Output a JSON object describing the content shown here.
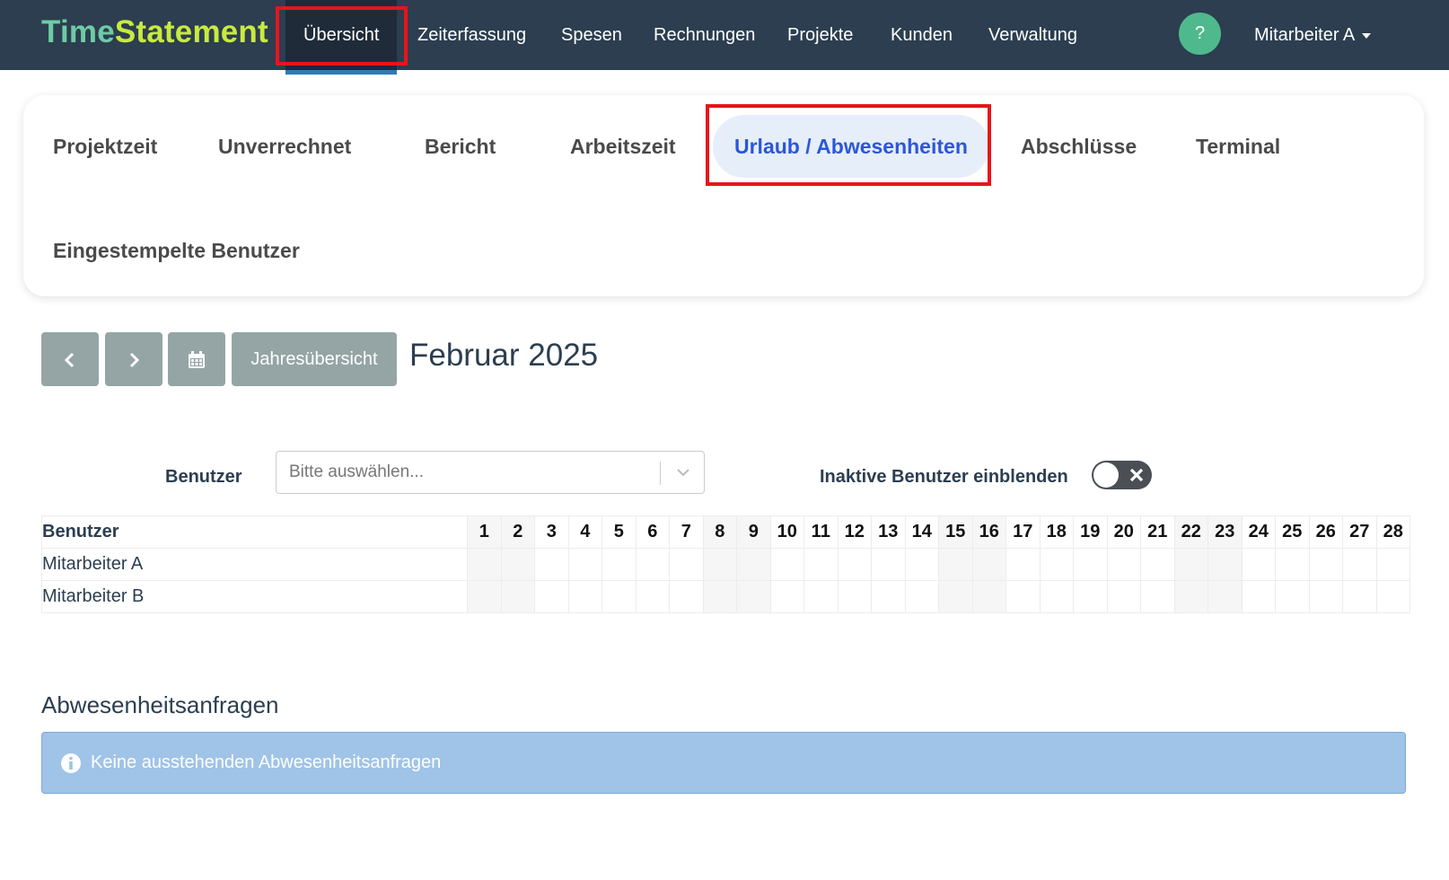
{
  "navbar": {
    "brand_part1": "Time",
    "brand_part2": "Statement",
    "items": [
      "Übersicht",
      "Zeiterfassung",
      "Spesen",
      "Rechnungen",
      "Projekte",
      "Kunden",
      "Verwaltung"
    ],
    "active_item": "Übersicht",
    "help_label": "?",
    "user_label": "Mitarbeiter A"
  },
  "tabs": {
    "items": [
      "Projektzeit",
      "Unverrechnet",
      "Bericht",
      "Arbeitszeit",
      "Urlaub / Abwesenheiten",
      "Abschlüsse",
      "Terminal",
      "Eingestempelte Benutzer"
    ],
    "active": "Urlaub / Abwesenheiten"
  },
  "toolbar": {
    "prev_icon": "chevron-left-icon",
    "next_icon": "chevron-right-icon",
    "calendar_icon": "calendar-icon",
    "year_overview_label": "Jahresübersicht",
    "month_title": "Februar 2025"
  },
  "filter": {
    "user_label": "Benutzer",
    "user_placeholder": "Bitte auswählen...",
    "toggle_label": "Inaktive Benutzer einblenden",
    "toggle_on": false
  },
  "calendar": {
    "name_header": "Benutzer",
    "days": [
      "1",
      "2",
      "3",
      "4",
      "5",
      "6",
      "7",
      "8",
      "9",
      "10",
      "11",
      "12",
      "13",
      "14",
      "15",
      "16",
      "17",
      "18",
      "19",
      "20",
      "21",
      "22",
      "23",
      "24",
      "25",
      "26",
      "27",
      "28"
    ],
    "weekend_days": [
      1,
      2,
      8,
      9,
      15,
      16,
      22,
      23
    ],
    "users": [
      "Mitarbeiter A",
      "Mitarbeiter B"
    ]
  },
  "requests": {
    "title": "Abwesenheitsanfragen",
    "empty_message": "Keine ausstehenden Abwesenheitsanfragen"
  },
  "colors": {
    "navbar_bg": "#2c3e50",
    "brand_green": "#6fcba5",
    "brand_lime": "#c8ea3e",
    "active_tab_text": "#2c57d8",
    "active_tab_bg": "#e6eefa",
    "button_gray": "#95a5a6",
    "help_green": "#4fb98d",
    "alert_bg": "#a0c3e8"
  }
}
